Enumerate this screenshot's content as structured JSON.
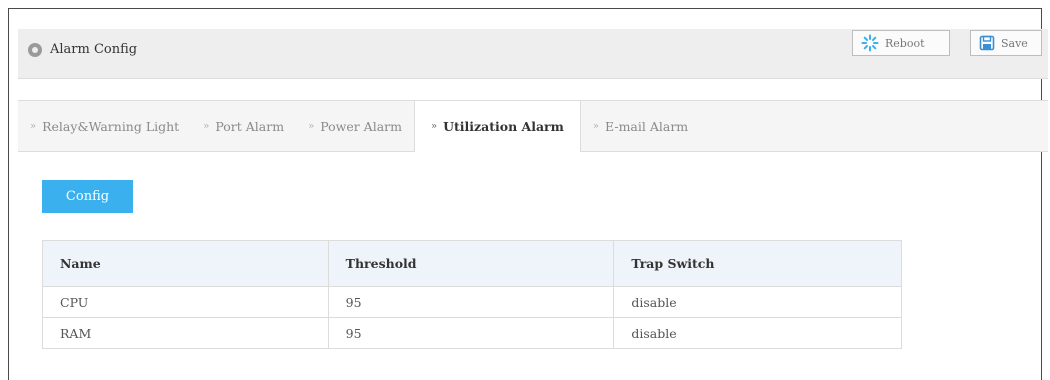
{
  "header": {
    "title": "Alarm Config",
    "location_icon": "location-pin-icon",
    "reboot": {
      "label": "Reboot",
      "icon": "spinner-icon",
      "icon_color": "#3bb0ef"
    },
    "save": {
      "label": "Save",
      "icon": "floppy-disk-icon",
      "icon_color": "#3b8ed6"
    }
  },
  "tabs": [
    {
      "label": "Relay&Warning Light",
      "active": false
    },
    {
      "label": "Port Alarm",
      "active": false
    },
    {
      "label": "Power Alarm",
      "active": false
    },
    {
      "label": "Utilization Alarm",
      "active": true
    },
    {
      "label": "E-mail Alarm",
      "active": false
    }
  ],
  "actions": {
    "config_label": "Config",
    "config_color": "#3bb0ef"
  },
  "table": {
    "columns": [
      "Name",
      "Threshold",
      "Trap Switch"
    ],
    "rows": [
      [
        "CPU",
        "95",
        "disable"
      ],
      [
        "RAM",
        "95",
        "disable"
      ]
    ]
  }
}
